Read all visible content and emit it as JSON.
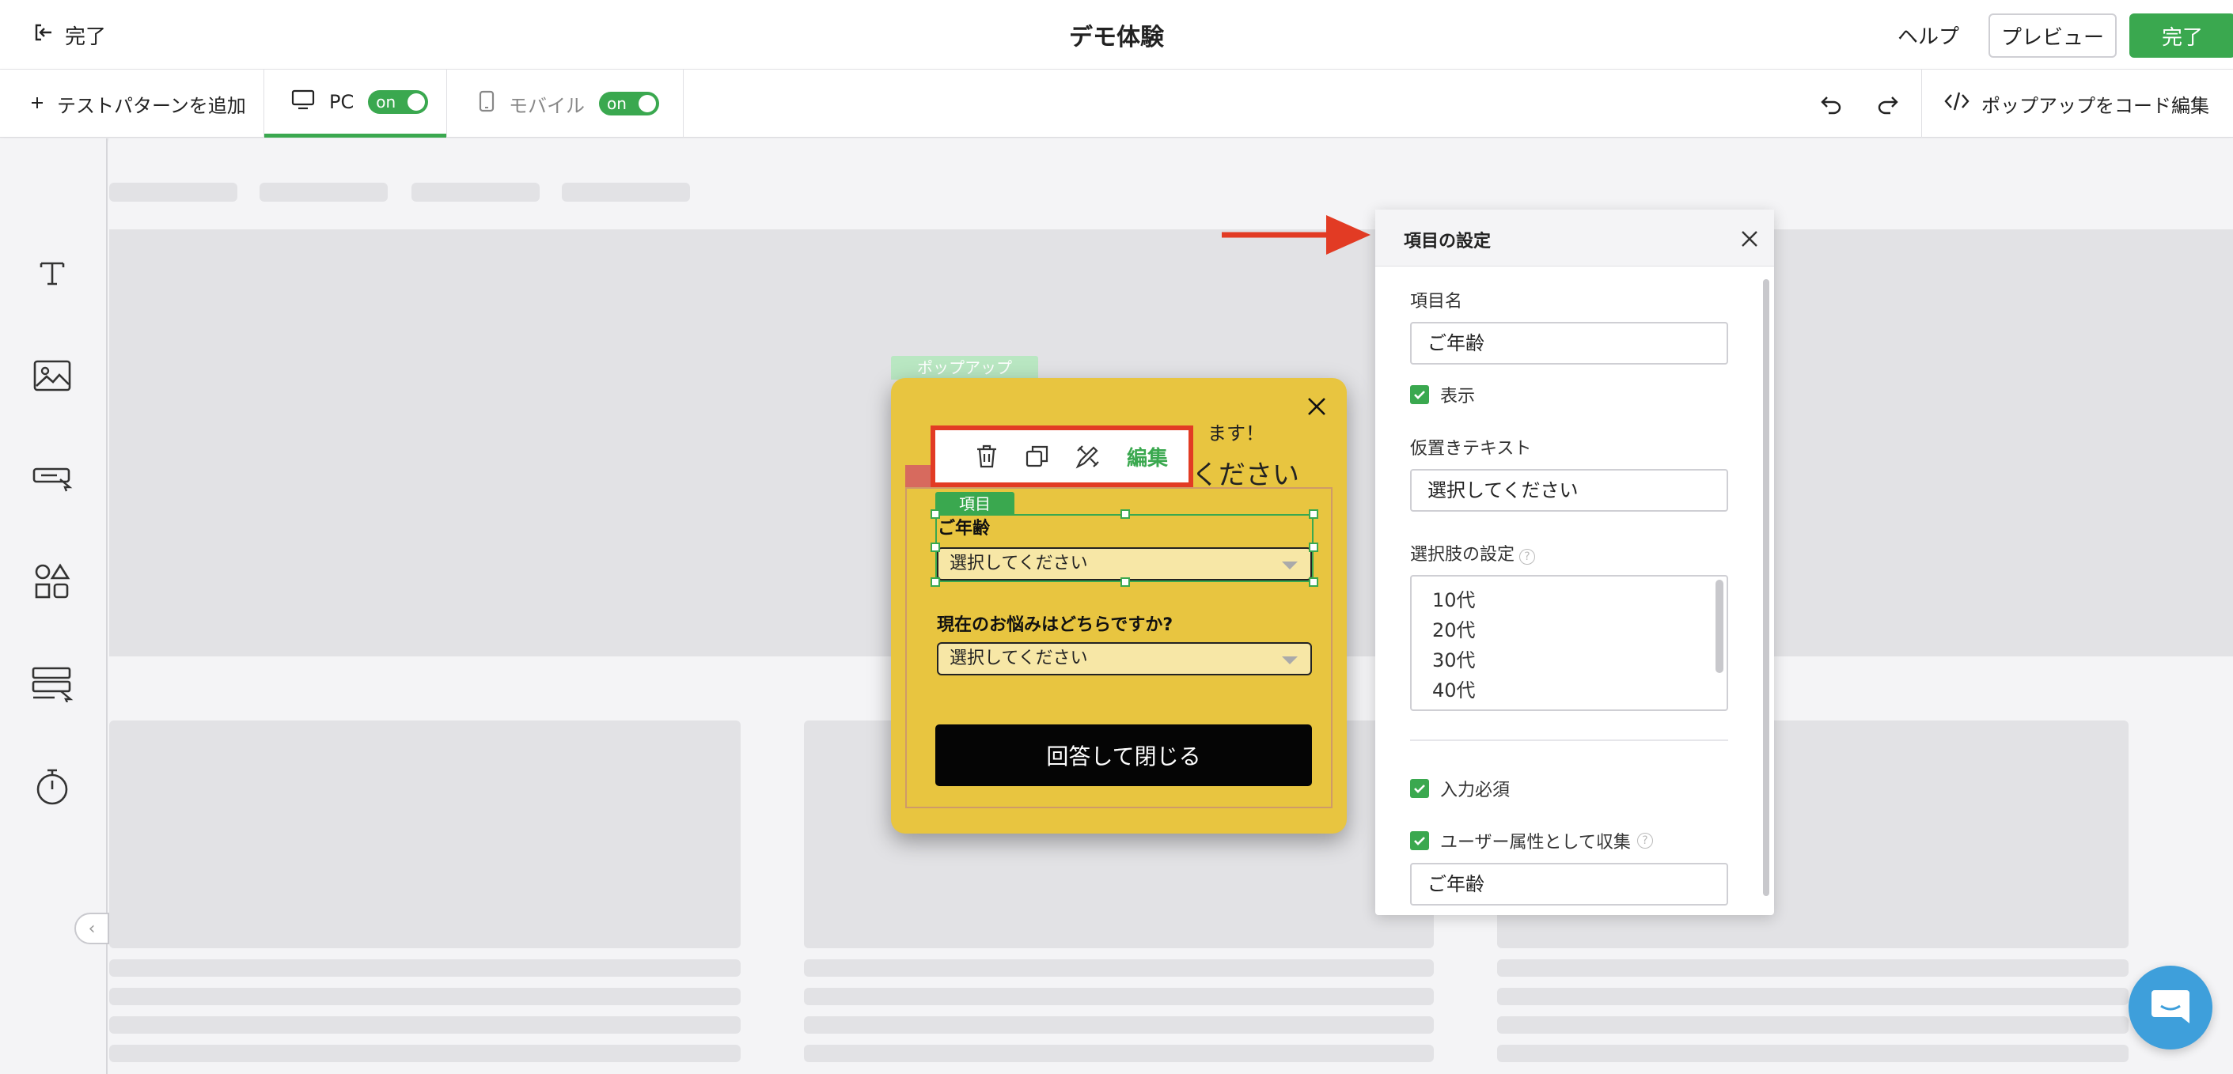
{
  "header": {
    "back_label": "完了",
    "title": "デモ体験",
    "help_label": "ヘルプ",
    "preview_label": "プレビュー",
    "done_label": "完了"
  },
  "toolbar": {
    "add_pattern_label": "テストパターンを追加",
    "pc_label": "PC",
    "pc_toggle": "on",
    "mobile_label": "モバイル",
    "mobile_toggle": "on",
    "code_edit_label": "ポップアップをコード編集"
  },
  "left_rail": {
    "tools": [
      "text-tool-icon",
      "image-tool-icon",
      "button-tool-icon",
      "shapes-tool-icon",
      "form-tool-icon",
      "timer-tool-icon"
    ]
  },
  "popup": {
    "tag": "ポップアップ",
    "subtitle": "ます！",
    "title": "ください",
    "item_tag": "項目",
    "edit_label": "編集",
    "questions": [
      {
        "label": "ご年齢",
        "placeholder": "選択してください"
      },
      {
        "label": "現在のお悩みはどちらですか?",
        "placeholder": "選択してください"
      }
    ],
    "submit_label": "回答して閉じる"
  },
  "settings_panel": {
    "title": "項目の設定",
    "item_name_label": "項目名",
    "item_name_value": "ご年齢",
    "show_label": "表示",
    "placeholder_label": "仮置きテキスト",
    "placeholder_value": "選択してください",
    "options_label": "選択肢の設定",
    "options": [
      "10代",
      "20代",
      "30代",
      "40代"
    ],
    "required_label": "入力必須",
    "collect_label": "ユーザー属性として収集",
    "collect_value": "ご年齢"
  },
  "colors": {
    "accent_green": "#3aa84f",
    "highlight_red": "#e23b24",
    "popup_yellow": "#e8c540",
    "chat_blue": "#3e9fdb"
  }
}
